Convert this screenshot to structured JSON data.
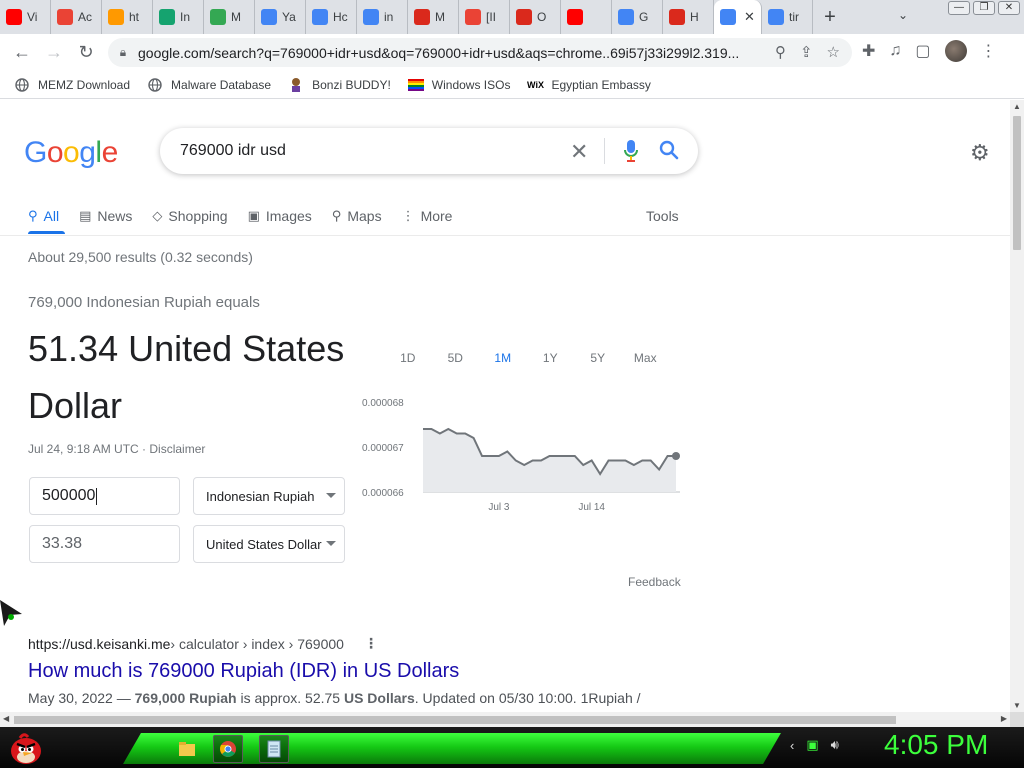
{
  "tabs": [
    {
      "label": "Vi",
      "icon": "youtube-icon",
      "color": "#ff0000"
    },
    {
      "label": "Ac",
      "icon": "gmail-icon",
      "color": "#ea4335"
    },
    {
      "label": "ht",
      "icon": "ph-icon",
      "color": "#ff9900"
    },
    {
      "label": "In",
      "icon": "green-app-icon",
      "color": "#15a36f"
    },
    {
      "label": "M",
      "icon": "drive-icon",
      "color": "#34a853"
    },
    {
      "label": "Ya",
      "icon": "maps-icon",
      "color": "#4285f4"
    },
    {
      "label": "Hc",
      "icon": "google-icon",
      "color": "#4285f4"
    },
    {
      "label": "in",
      "icon": "google-icon",
      "color": "#4285f4"
    },
    {
      "label": "M",
      "icon": "mcdonalds-icon",
      "color": "#da291c"
    },
    {
      "label": "[II",
      "icon": "gmail-icon",
      "color": "#ea4335"
    },
    {
      "label": "O",
      "icon": "mcdonalds-icon",
      "color": "#da291c"
    },
    {
      "label": "",
      "icon": "youtube-audio-icon",
      "color": "#ff0000"
    },
    {
      "label": "G",
      "icon": "translate-icon",
      "color": "#4285f4"
    },
    {
      "label": "H",
      "icon": "mcdonalds-icon",
      "color": "#da291c"
    },
    {
      "label": "",
      "icon": "google-icon",
      "color": "#4285f4",
      "active": true
    },
    {
      "label": "tir",
      "icon": "google-icon",
      "color": "#4285f4"
    }
  ],
  "toolbar": {
    "url": "google.com/search?q=769000+idr+usd&oq=769000+idr+usd&aqs=chrome..69i57j33i299l2.319..."
  },
  "bookmarks": [
    {
      "label": "MEMZ Download",
      "icon": "globe-icon"
    },
    {
      "label": "Malware Database",
      "icon": "globe-icon"
    },
    {
      "label": "Bonzi BUDDY!",
      "icon": "bonzi-icon"
    },
    {
      "label": "Windows ISOs",
      "icon": "rainbow-flag-icon"
    },
    {
      "label": "Egyptian Embassy",
      "icon": "wix-icon"
    }
  ],
  "search": {
    "query": "769000 idr usd"
  },
  "nav": {
    "all": "All",
    "news": "News",
    "shopping": "Shopping",
    "images": "Images",
    "maps": "Maps",
    "more": "More",
    "tools": "Tools"
  },
  "stats": "About 29,500 results (0.32 seconds)",
  "converter": {
    "equals_text": "769,000 Indonesian Rupiah equals",
    "result_text": "51.34 United States Dollar",
    "timestamp": "Jul 24, 9:18 AM UTC · Disclaimer",
    "from_value": "500000",
    "from_currency": "Indonesian Rupiah",
    "to_value": "33.38",
    "to_currency": "United States Dollar",
    "ranges": [
      "1D",
      "5D",
      "1M",
      "1Y",
      "5Y",
      "Max"
    ],
    "selected_range": "1M",
    "feedback": "Feedback"
  },
  "chart_data": {
    "type": "area",
    "y_ticks": [
      "0.000068",
      "0.000067",
      "0.000066"
    ],
    "ylim": [
      6.6e-05,
      6.8e-05
    ],
    "x_labels": [
      "Jul 3",
      "Jul 14"
    ],
    "x": [
      "Jun 24",
      "Jun 25",
      "Jun 26",
      "Jun 27",
      "Jun 28",
      "Jun 29",
      "Jun 30",
      "Jul 1",
      "Jul 2",
      "Jul 3",
      "Jul 4",
      "Jul 5",
      "Jul 6",
      "Jul 7",
      "Jul 8",
      "Jul 9",
      "Jul 10",
      "Jul 11",
      "Jul 12",
      "Jul 13",
      "Jul 14",
      "Jul 15",
      "Jul 16",
      "Jul 17",
      "Jul 18",
      "Jul 19",
      "Jul 20",
      "Jul 21",
      "Jul 22",
      "Jul 23",
      "Jul 24"
    ],
    "values": [
      6.74e-05,
      6.74e-05,
      6.73e-05,
      6.74e-05,
      6.73e-05,
      6.73e-05,
      6.72e-05,
      6.68e-05,
      6.68e-05,
      6.68e-05,
      6.69e-05,
      6.67e-05,
      6.66e-05,
      6.67e-05,
      6.67e-05,
      6.68e-05,
      6.68e-05,
      6.68e-05,
      6.68e-05,
      6.66e-05,
      6.67e-05,
      6.64e-05,
      6.67e-05,
      6.67e-05,
      6.67e-05,
      6.66e-05,
      6.67e-05,
      6.67e-05,
      6.65e-05,
      6.68e-05,
      6.68e-05
    ],
    "line_color": "#70757a",
    "fill_color": "#e8eaed"
  },
  "result1": {
    "site": "https://usd.keisanki.me",
    "path": " › calculator › index › 769000",
    "title": "How much is 769000 Rupiah (IDR) in US Dollars",
    "snippet_date": "May 30, 2022 — ",
    "snippet_bold1": "769,000 Rupiah",
    "snippet_mid": " is approx. 52.75 ",
    "snippet_bold2": "US Dollars",
    "snippet_end": ". Updated on 05/30 10:00. 1Rupiah /"
  },
  "taskbar": {
    "clock": "4:05 PM"
  },
  "colors": {
    "accent": "#1a73e8",
    "link": "#1a0dab",
    "taskbar_green": "#15c915"
  }
}
